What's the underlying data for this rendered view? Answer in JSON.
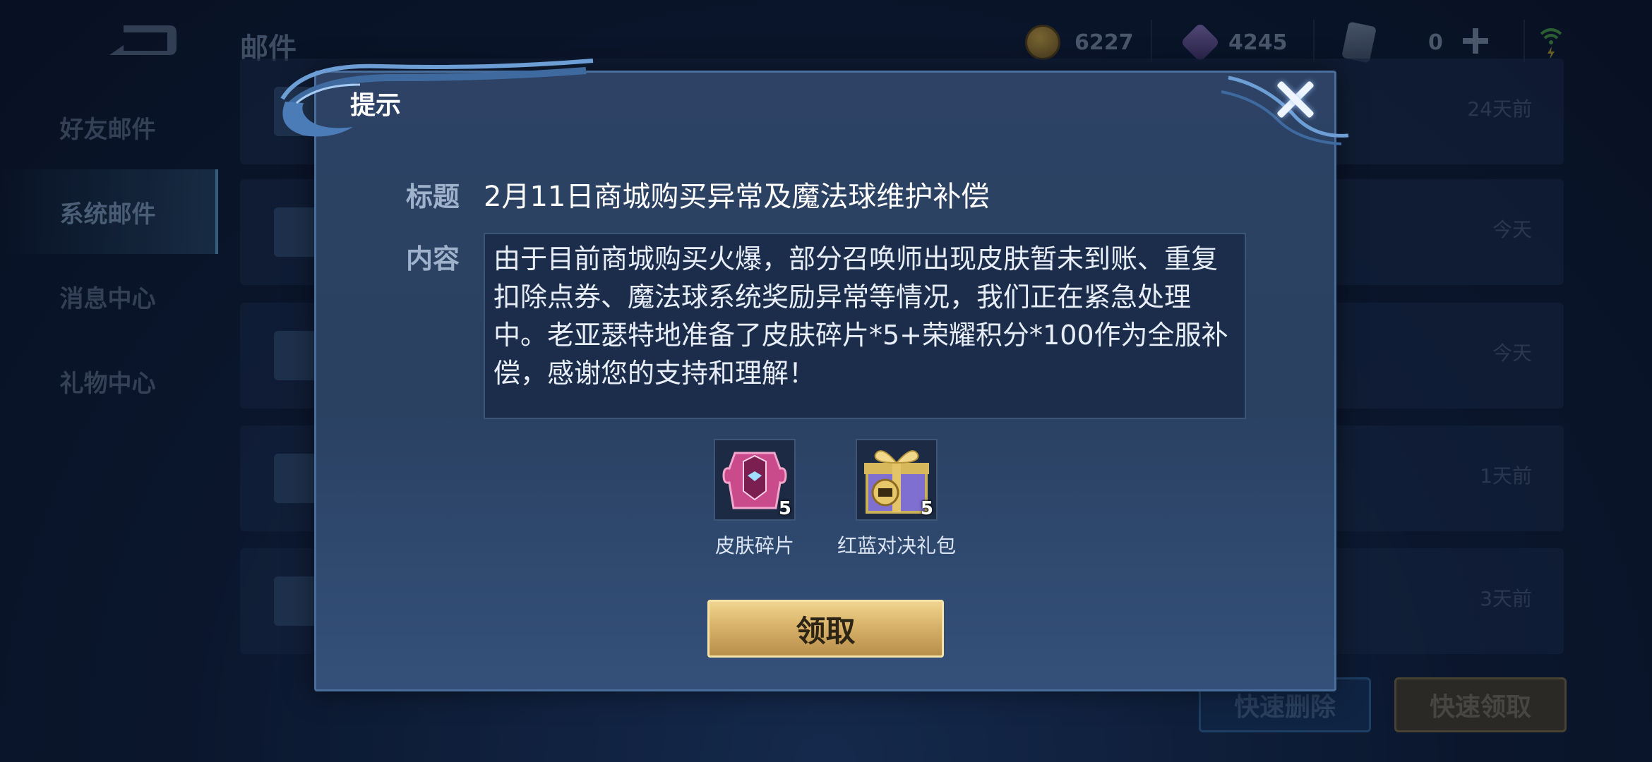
{
  "header": {
    "title": "邮件",
    "gold": "6227",
    "diamonds": "4245",
    "vouchers": "0"
  },
  "sidebar": {
    "items": [
      {
        "label": "好友邮件"
      },
      {
        "label": "系统邮件"
      },
      {
        "label": "消息中心"
      },
      {
        "label": "礼物中心"
      }
    ]
  },
  "mail_list": {
    "rows": [
      {
        "time": "24天前"
      },
      {
        "time": "今天"
      },
      {
        "time": "今天"
      },
      {
        "time": "1天前"
      },
      {
        "time": "3天前"
      }
    ]
  },
  "footer": {
    "delete_label": "快速删除",
    "claim_all_label": "快速领取"
  },
  "dialog": {
    "title": "提示",
    "subject_label": "标题",
    "subject": "2月11日商城购买异常及魔法球维护补偿",
    "content_label": "内容",
    "content": "由于目前商城购买火爆，部分召唤师出现皮肤暂未到账、重复扣除点券、魔法球系统奖励异常等情况，我们正在紧急处理中。老亚瑟特地准备了皮肤碎片*5+荣耀积分*100作为全服补偿，感谢您的支持和理解！",
    "rewards": [
      {
        "name": "皮肤碎片",
        "count": "5",
        "icon": "skin-fragment-icon"
      },
      {
        "name": "红蓝对决礼包",
        "count": "5",
        "icon": "gift-box-icon"
      }
    ],
    "claim_label": "领取"
  },
  "colors": {
    "accent_gold": "#d8b26a",
    "panel": "#2d4264"
  }
}
